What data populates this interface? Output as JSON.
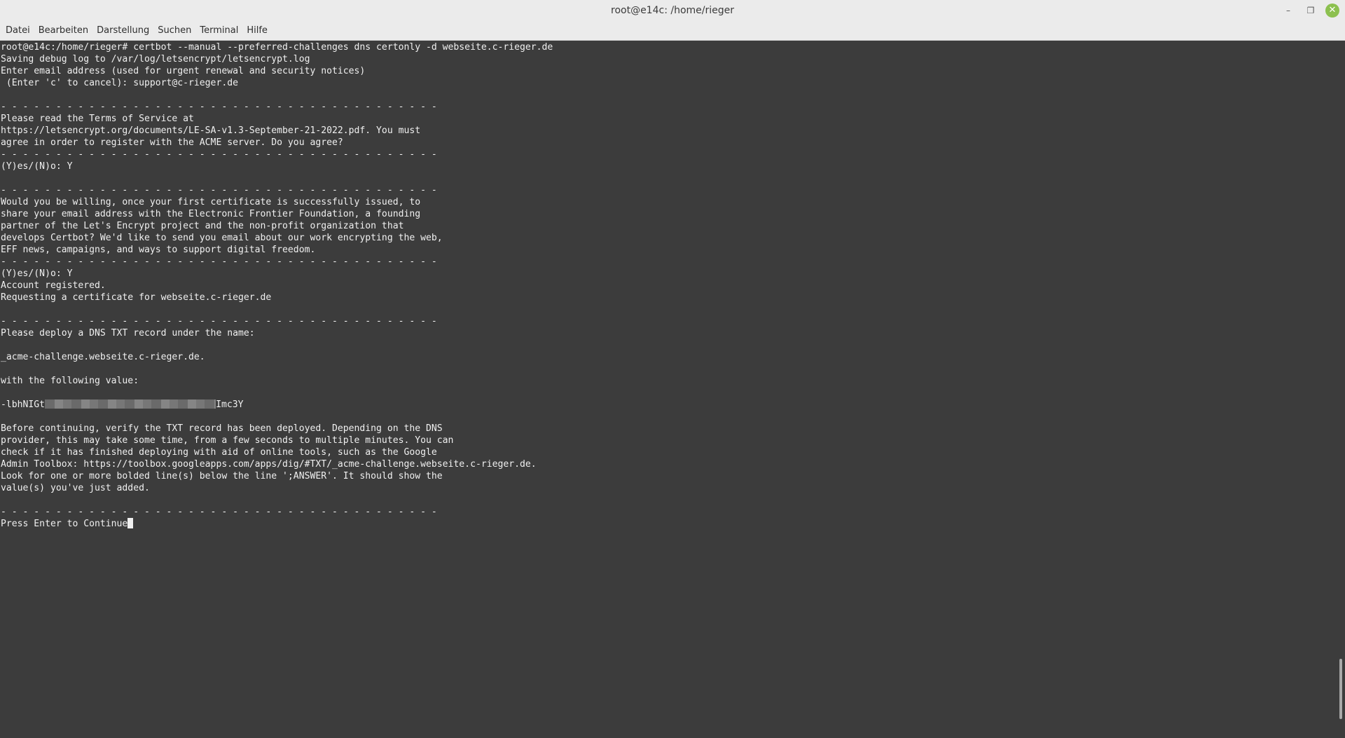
{
  "window": {
    "title": "root@e14c: /home/rieger",
    "minimize_glyph": "–",
    "maximize_glyph": "❐",
    "close_glyph": "✕",
    "close_color": "#8cc04f"
  },
  "menubar": {
    "items": [
      "Datei",
      "Bearbeiten",
      "Darstellung",
      "Suchen",
      "Terminal",
      "Hilfe"
    ]
  },
  "terminal": {
    "background": "#3c3c3c",
    "foreground": "#f0f0f0",
    "redacted_prefix": "-lbhNIGt",
    "redacted_suffix": "Imc3Y",
    "lines": [
      "root@e14c:/home/rieger# certbot --manual --preferred-challenges dns certonly -d webseite.c-rieger.de",
      "Saving debug log to /var/log/letsencrypt/letsencrypt.log",
      "Enter email address (used for urgent renewal and security notices)",
      " (Enter 'c' to cancel): support@c-rieger.de",
      "",
      "- - - - - - - - - - - - - - - - - - - - - - - - - - - - - - - - - - - - - - - -",
      "Please read the Terms of Service at",
      "https://letsencrypt.org/documents/LE-SA-v1.3-September-21-2022.pdf. You must",
      "agree in order to register with the ACME server. Do you agree?",
      "- - - - - - - - - - - - - - - - - - - - - - - - - - - - - - - - - - - - - - - -",
      "(Y)es/(N)o: Y",
      "",
      "- - - - - - - - - - - - - - - - - - - - - - - - - - - - - - - - - - - - - - - -",
      "Would you be willing, once your first certificate is successfully issued, to",
      "share your email address with the Electronic Frontier Foundation, a founding",
      "partner of the Let's Encrypt project and the non-profit organization that",
      "develops Certbot? We'd like to send you email about our work encrypting the web,",
      "EFF news, campaigns, and ways to support digital freedom.",
      "- - - - - - - - - - - - - - - - - - - - - - - - - - - - - - - - - - - - - - - -",
      "(Y)es/(N)o: Y",
      "Account registered.",
      "Requesting a certificate for webseite.c-rieger.de",
      "",
      "- - - - - - - - - - - - - - - - - - - - - - - - - - - - - - - - - - - - - - - -",
      "Please deploy a DNS TXT record under the name:",
      "",
      "_acme-challenge.webseite.c-rieger.de.",
      "",
      "with the following value:",
      "",
      "__REDACTED__",
      "",
      "Before continuing, verify the TXT record has been deployed. Depending on the DNS",
      "provider, this may take some time, from a few seconds to multiple minutes. You can",
      "check if it has finished deploying with aid of online tools, such as the Google",
      "Admin Toolbox: https://toolbox.googleapps.com/apps/dig/#TXT/_acme-challenge.webseite.c-rieger.de.",
      "Look for one or more bolded line(s) below the line ';ANSWER'. It should show the",
      "value(s) you've just added.",
      "",
      "- - - - - - - - - - - - - - - - - - - - - - - - - - - - - - - - - - - - - - - -",
      "Press Enter to Continue"
    ],
    "scroll_position": 0.97
  }
}
